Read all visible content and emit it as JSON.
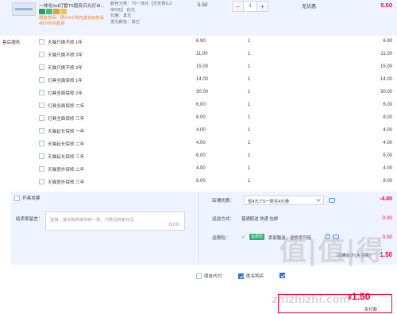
{
  "product": {
    "title": "一体化led灯管T5超亮日光灯t8...",
    "promo": "限购时间：预计4小时内发货(8件请48小时内发货",
    "sku_lines": [
      "颜色分类：T5一体化【方形款0.3",
      "米5瓦】 白光",
      "长度：其它",
      "发光颜色：其它"
    ],
    "unit_price": "5.50",
    "quantity": "1",
    "minus": "−",
    "plus": "+",
    "discount": "无优惠",
    "sum": "5.50"
  },
  "services": {
    "label": "售后服务",
    "rows": [
      {
        "name": "天猫只换不修 1年",
        "price": "6.90",
        "qty": "1",
        "total": "6.90"
      },
      {
        "name": "天猫只换不修 2年",
        "price": "11.00",
        "qty": "1",
        "total": "11.00"
      },
      {
        "name": "天猫只换不修 3年",
        "price": "15.00",
        "qty": "1",
        "total": "15.00"
      },
      {
        "name": "灯具全面保修 1年",
        "price": "14.00",
        "qty": "1",
        "total": "14.00"
      },
      {
        "name": "灯具全面保修 2年",
        "price": "30.00",
        "qty": "1",
        "total": "30.00"
      },
      {
        "name": "灯具全面保修 二年",
        "price": "6.00",
        "qty": "1",
        "total": "6.00"
      },
      {
        "name": "灯具全面保修 三年",
        "price": "8.00",
        "qty": "1",
        "total": "8.00"
      },
      {
        "name": "天猫延长保修 一年",
        "price": "4.00",
        "qty": "1",
        "total": "4.00"
      },
      {
        "name": "天猫延长保修 二年",
        "price": "4.00",
        "qty": "1",
        "total": "4.00"
      },
      {
        "name": "天猫延长保修 三年",
        "price": "6.00",
        "qty": "1",
        "total": "6.00"
      },
      {
        "name": "天猫意外保修 二年",
        "price": "4.00",
        "qty": "1",
        "total": "4.00"
      },
      {
        "name": "天猫意外保修 三年",
        "price": "8.00",
        "qty": "1",
        "total": "8.00"
      }
    ]
  },
  "order": {
    "invoice_label": "开具发票",
    "message_label": "给卖家留言：",
    "message_placeholder": "选填，填充和商家协商一致，付款后商家可见",
    "message_count": "0/200",
    "coupon_label": "店铺优惠：",
    "coupon_value": "省4元:TS一体化4元卷",
    "coupon_amount": "-4.00",
    "shipping_label": "运送方式：",
    "shipping_value": "普通配送 快递 包邮",
    "shipping_amount": "0.00",
    "insurance_label": "运费险：",
    "insurance_check": "✓",
    "insurance_tag": "运费险",
    "insurance_text": "卖家赠送，退换货可赔",
    "insurance_help": "?",
    "insurance_amount": "0.00",
    "subtotal_label": "店铺合计(含运费)",
    "subtotal_amount": "1.50"
  },
  "bottom": {
    "friend_pay_label": "朋友代付",
    "anonymous_label": "匿名购买",
    "pay_label": "实付款：",
    "pay_symbol": "¥",
    "pay_amount": "1.50"
  },
  "watermark": {
    "logo": "值|值|得",
    "url": "zhizhizhi.com"
  },
  "colors": {
    "accent": "#ff0036",
    "panel": "#eef3ff",
    "promo": "#f07b1d",
    "link": "#2f6fd8"
  }
}
